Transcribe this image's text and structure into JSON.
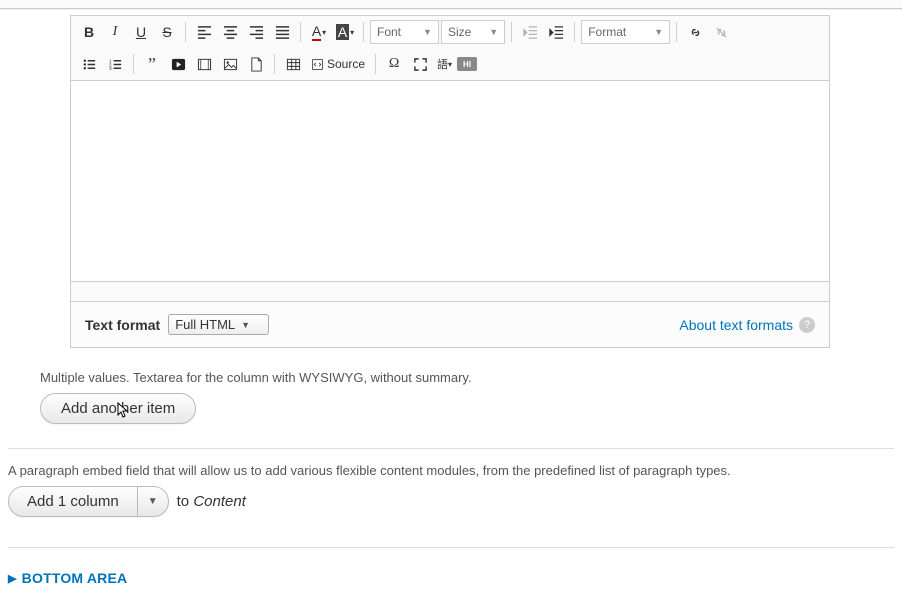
{
  "editor": {
    "toolbar": {
      "font_label": "Font",
      "size_label": "Size",
      "format_label": "Format",
      "source_label": "Source"
    }
  },
  "text_format": {
    "label": "Text format",
    "selected": "Full HTML",
    "about_link": "About text formats"
  },
  "multivalue_help": "Multiple values. Textarea for the column with WYSIWYG, without summary.",
  "add_another_label": "Add another item",
  "paragraph_help": "A paragraph embed field that will allow us to add various flexible content modules, from the predefined list of paragraph types.",
  "add_column": {
    "button_label": "Add 1 column",
    "to_prefix": "to ",
    "to_target": "Content"
  },
  "bottom_area_label": "BOTTOM AREA"
}
